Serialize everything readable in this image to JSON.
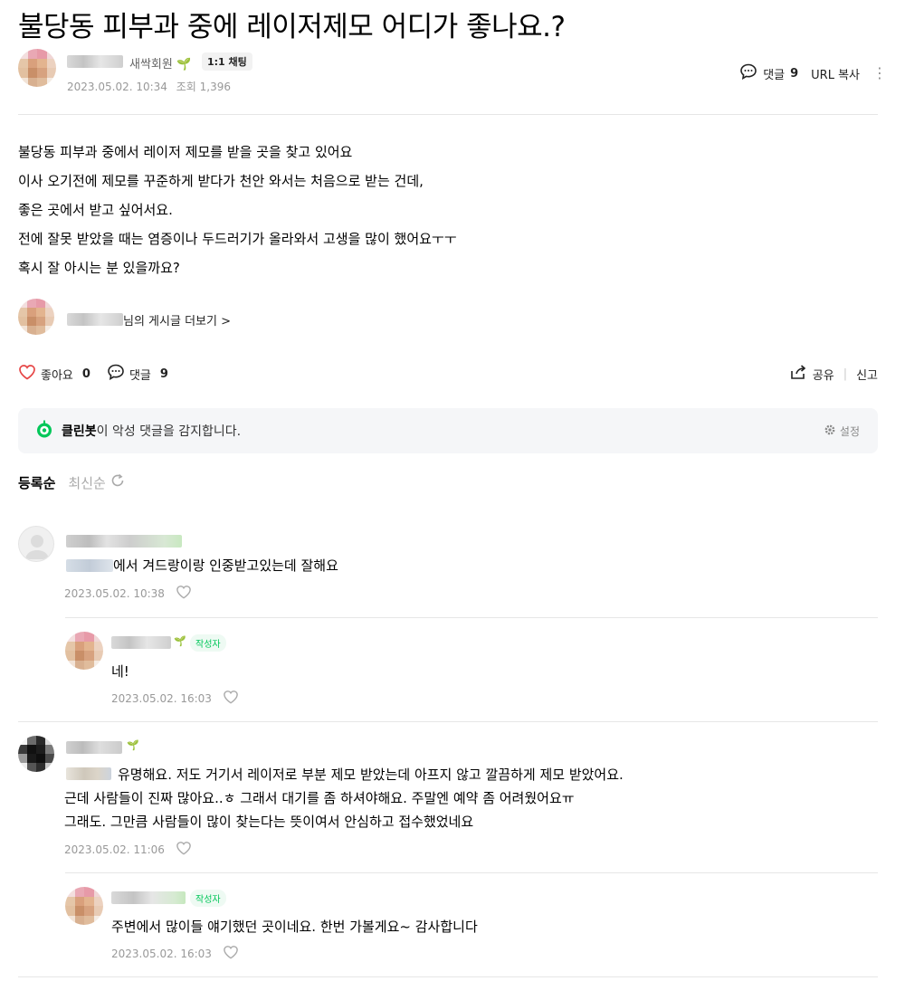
{
  "post": {
    "title": "불당동 피부과 중에 레이저제모 어디가 좋나요.?",
    "author": {
      "grade": "새싹회원",
      "chat_label": "1:1 채팅",
      "date": "2023.05.02. 10:34",
      "views": "조회 1,396"
    },
    "actions": {
      "comments_label": "댓글",
      "comments_count": "9",
      "url_copy": "URL 복사"
    },
    "body": [
      "불당동 피부과 중에서 레이저 제모를 받을 곳을 찾고 있어요",
      "이사 오기전에 제모를 꾸준하게 받다가 천안 와서는 처음으로 받는 건데,",
      "좋은 곳에서 받고 싶어서요.",
      "전에 잘못 받았을 때는 염증이나 두드러기가 올라와서 고생을 많이 했어요ㅜㅜ",
      "혹시 잘 아시는 분 있을까요?"
    ],
    "more_posts": "님의 게시글 더보기 >"
  },
  "engagement": {
    "like_label": "좋아요",
    "like_count": "0",
    "comment_label": "댓글",
    "comment_count": "9",
    "share": "공유",
    "report": "신고"
  },
  "cleanbot": {
    "name": "클린봇",
    "message": "이 악성 댓글을 감지합니다.",
    "settings": "설정"
  },
  "sort": {
    "active": "등록순",
    "inactive": "최신순"
  },
  "comments": [
    {
      "content": "에서 겨드랑이랑 인중받고있는데 잘해요",
      "date": "2023.05.02. 10:38"
    },
    {
      "badge": "작성자",
      "content": "네!",
      "date": "2023.05.02. 16:03"
    },
    {
      "lines": [
        "유명해요. 저도 거기서 레이저로 부분 제모 받았는데 아프지 않고 깔끔하게 제모 받았어요.",
        "근데 사람들이 진짜 많아요..ㅎ 그래서 대기를 좀 하셔야해요. 주말엔 예약 좀 어려웠어요ㅠ",
        "그래도. 그만큼 사람들이 많이 찾는다는 뜻이여서 안심하고 접수했었네요"
      ],
      "date": "2023.05.02. 11:06"
    },
    {
      "badge": "작성자",
      "content": "주변에서 많이들 얘기했던 곳이네요. 한번 가볼게요~ 감사합니다",
      "date": "2023.05.02. 16:03"
    }
  ],
  "colors": {
    "accent_green": "#03c75a",
    "like_heart": "#e64545",
    "divider": "#e6e6e6",
    "muted": "#999999"
  }
}
